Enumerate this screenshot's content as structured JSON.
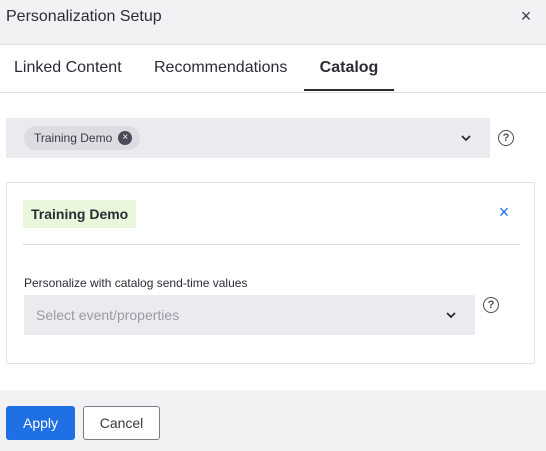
{
  "dialog": {
    "title": "Personalization Setup",
    "close_icon": "×"
  },
  "tabs": [
    {
      "label": "Linked Content",
      "active": false
    },
    {
      "label": "Recommendations",
      "active": false
    },
    {
      "label": "Catalog",
      "active": true
    }
  ],
  "catalog_select": {
    "selected_chip": "Training Demo",
    "chip_remove_icon": "×",
    "help_icon": "?"
  },
  "catalog_card": {
    "tag": "Training Demo",
    "remove_icon": "×",
    "field_label": "Personalize with catalog send-time values",
    "select_placeholder": "Select event/properties",
    "help_icon": "?"
  },
  "footer": {
    "apply_label": "Apply",
    "cancel_label": "Cancel"
  },
  "colors": {
    "accent": "#1f6fe5",
    "tag_bg": "#e9f7dc",
    "field_bg": "#ebebef",
    "header_bg": "#f2f2f4"
  }
}
